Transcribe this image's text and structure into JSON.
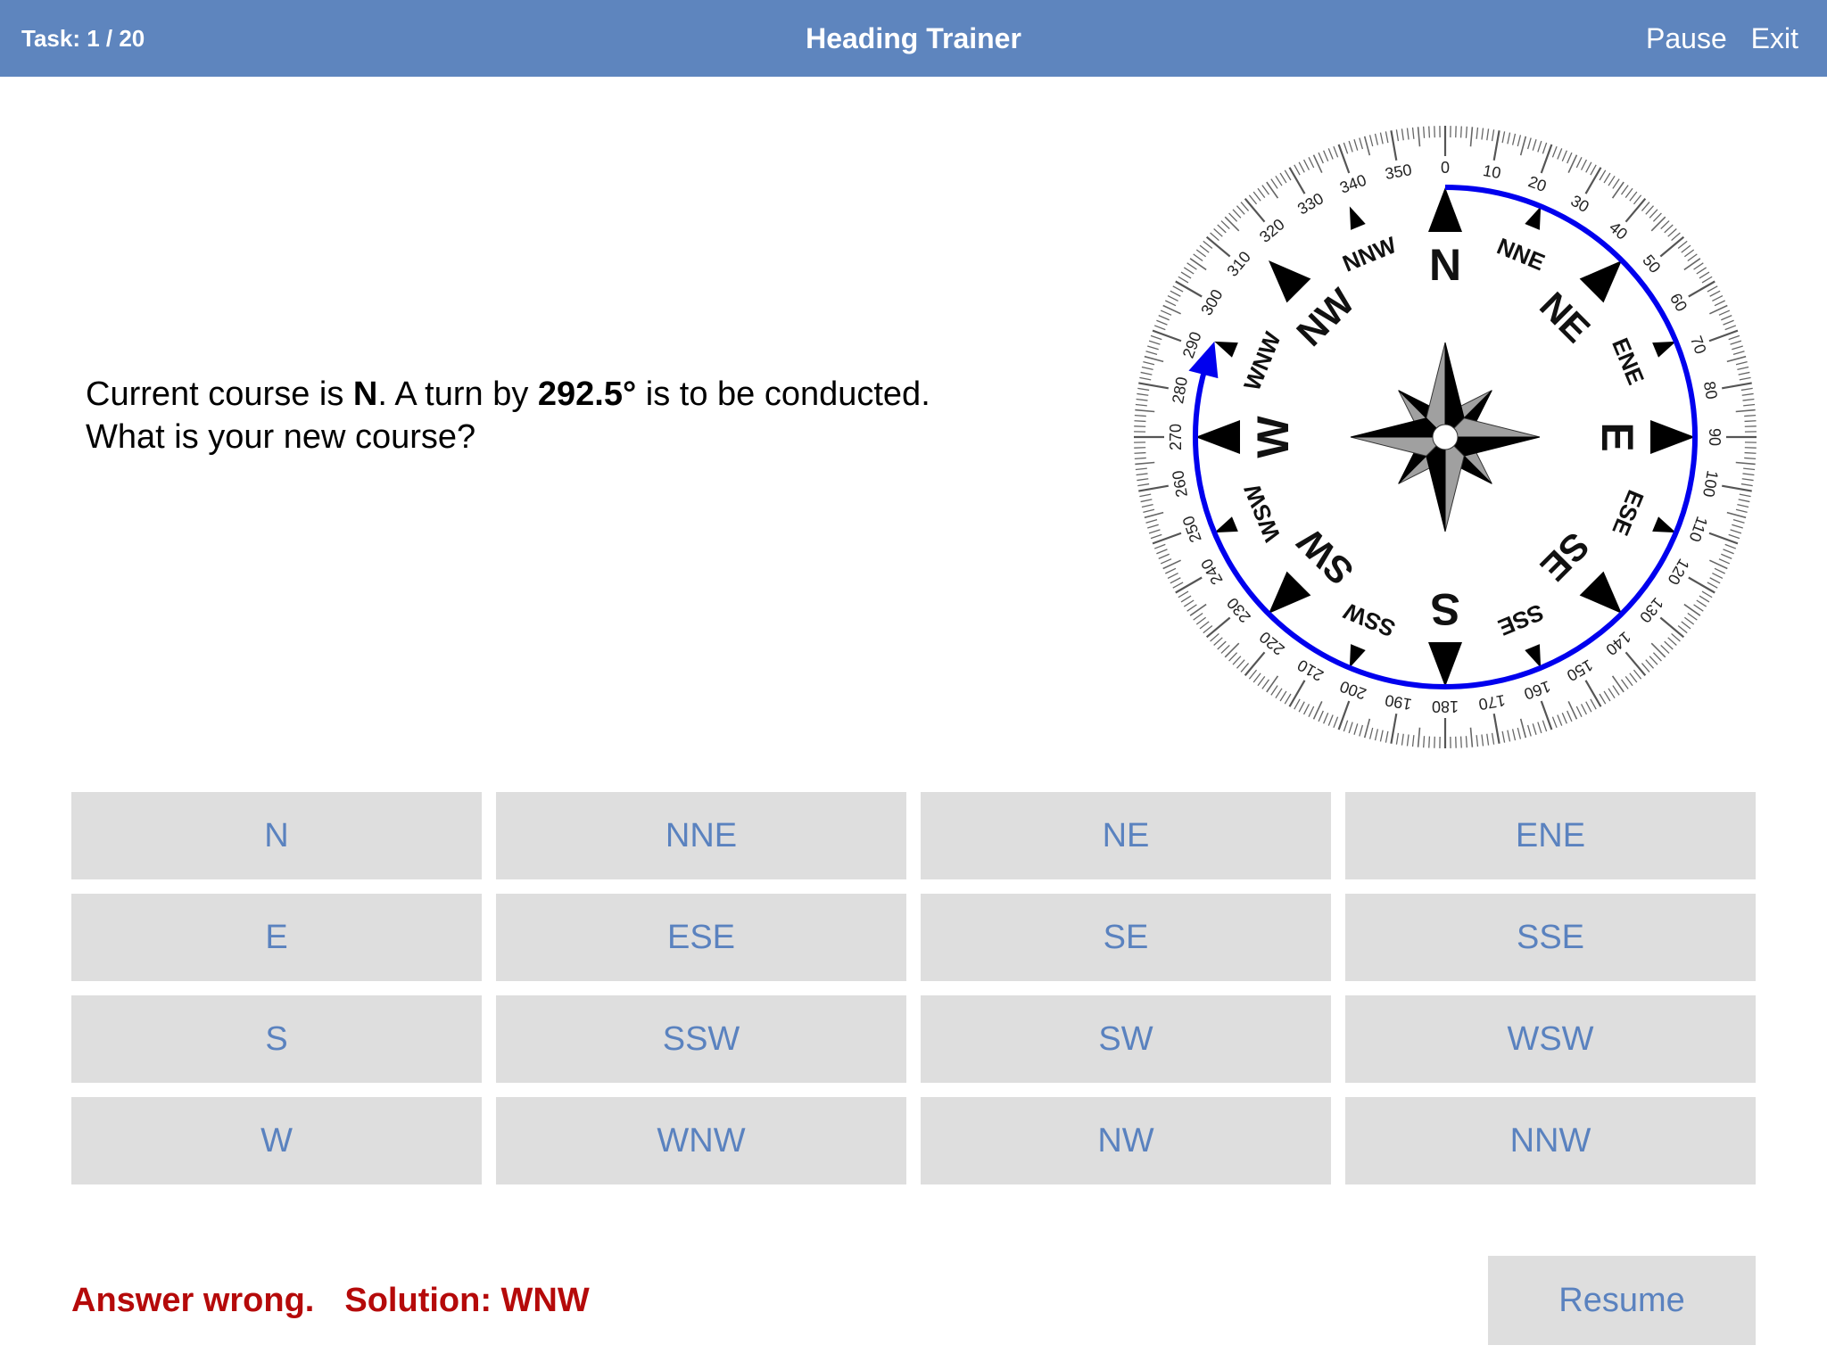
{
  "header": {
    "task_label": "Task: 1 / 20",
    "title": "Heading Trainer",
    "pause_label": "Pause",
    "exit_label": "Exit",
    "background_color": "#5E85BE"
  },
  "question": {
    "prefix": "Current course is ",
    "current_course": "N",
    "middle": ". A turn by ",
    "turn_amount": "292.5°",
    "suffix": " is to be conducted.",
    "line2": "What is your new course?"
  },
  "compass": {
    "start_heading_deg": 0,
    "turn_deg": 292.5,
    "turn_direction": "clockwise",
    "arc_color": "#0000EE",
    "degree_labels": [
      "0",
      "10",
      "20",
      "30",
      "40",
      "50",
      "60",
      "70",
      "80",
      "90",
      "100",
      "110",
      "120",
      "130",
      "140",
      "150",
      "160",
      "170",
      "180",
      "190",
      "200",
      "210",
      "220",
      "230",
      "240",
      "250",
      "260",
      "270",
      "280",
      "290",
      "300",
      "310",
      "320",
      "330",
      "340",
      "350"
    ],
    "cardinal_labels": [
      "N",
      "E",
      "S",
      "W"
    ],
    "intercardinal_labels": [
      "NE",
      "SE",
      "SW",
      "NW"
    ],
    "secondary_labels": [
      "NNE",
      "ENE",
      "ESE",
      "SSE",
      "SSW",
      "WSW",
      "WNW",
      "NNW"
    ]
  },
  "answers": [
    {
      "label": "N"
    },
    {
      "label": "NNE"
    },
    {
      "label": "NE"
    },
    {
      "label": "ENE"
    },
    {
      "label": "E"
    },
    {
      "label": "ESE"
    },
    {
      "label": "SE"
    },
    {
      "label": "SSE"
    },
    {
      "label": "S"
    },
    {
      "label": "SSW"
    },
    {
      "label": "SW"
    },
    {
      "label": "WSW"
    },
    {
      "label": "W"
    },
    {
      "label": "WNW"
    },
    {
      "label": "NW"
    },
    {
      "label": "NNW"
    }
  ],
  "feedback": {
    "result": "Answer wrong.",
    "solution": "Solution: WNW",
    "color": "#B50A0A"
  },
  "resume_label": "Resume"
}
